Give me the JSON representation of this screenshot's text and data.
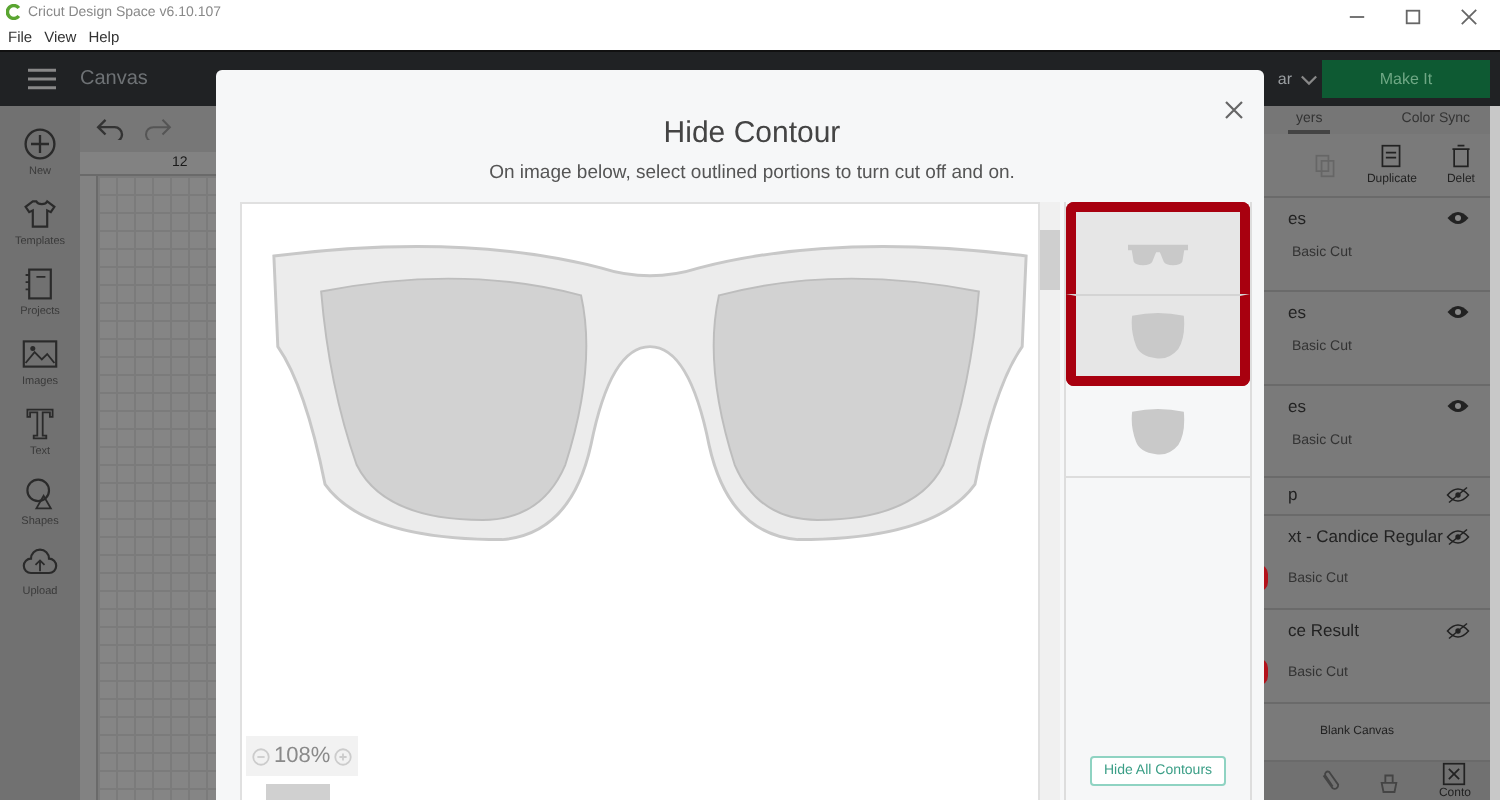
{
  "app": {
    "title": "Cricut Design Space  v6.10.107",
    "menu": [
      "File",
      "View",
      "Help"
    ]
  },
  "header": {
    "page": "Canvas",
    "machine": "ar",
    "make_button": "Make It"
  },
  "sidebar": [
    {
      "kind": "new",
      "label": "New"
    },
    {
      "kind": "templates",
      "label": "Templates"
    },
    {
      "kind": "projects",
      "label": "Projects"
    },
    {
      "kind": "images",
      "label": "Images"
    },
    {
      "kind": "text",
      "label": "Text"
    },
    {
      "kind": "shapes",
      "label": "Shapes"
    },
    {
      "kind": "upload",
      "label": "Upload"
    }
  ],
  "canvas": {
    "ruler_mark": "12"
  },
  "layers_panel": {
    "tabs": [
      {
        "label": "yers",
        "selected": true
      },
      {
        "label": "Color Sync",
        "selected": false
      }
    ],
    "actions": [
      {
        "kind": "duplicate",
        "label": "Duplicate"
      },
      {
        "kind": "delete",
        "label": "Delet"
      }
    ],
    "layers": [
      {
        "name": "es",
        "operation": "Basic Cut",
        "visible": true
      },
      {
        "name": "es",
        "operation": "Basic Cut",
        "visible": true
      },
      {
        "name": "es",
        "operation": "Basic Cut",
        "visible": true
      },
      {
        "name": "p",
        "visible": false
      },
      {
        "name": "xt - Candice Regular",
        "operation": "Basic Cut",
        "visible": false,
        "color": "#b3121b"
      },
      {
        "name": "ce Result",
        "operation": "Basic Cut",
        "visible": false,
        "color": "#b3121b"
      }
    ],
    "blank": "Blank Canvas",
    "bottom_tool": "Conto"
  },
  "dialog": {
    "title": "Hide Contour",
    "instruction": "On image below, select outlined portions to turn cut off and on.",
    "zoom": "108%",
    "thumbnails": [
      {
        "kind": "glasses",
        "selected": true
      },
      {
        "kind": "lens",
        "selected": true
      },
      {
        "kind": "lens",
        "selected": false
      }
    ],
    "button": "Hide All Contours"
  }
}
